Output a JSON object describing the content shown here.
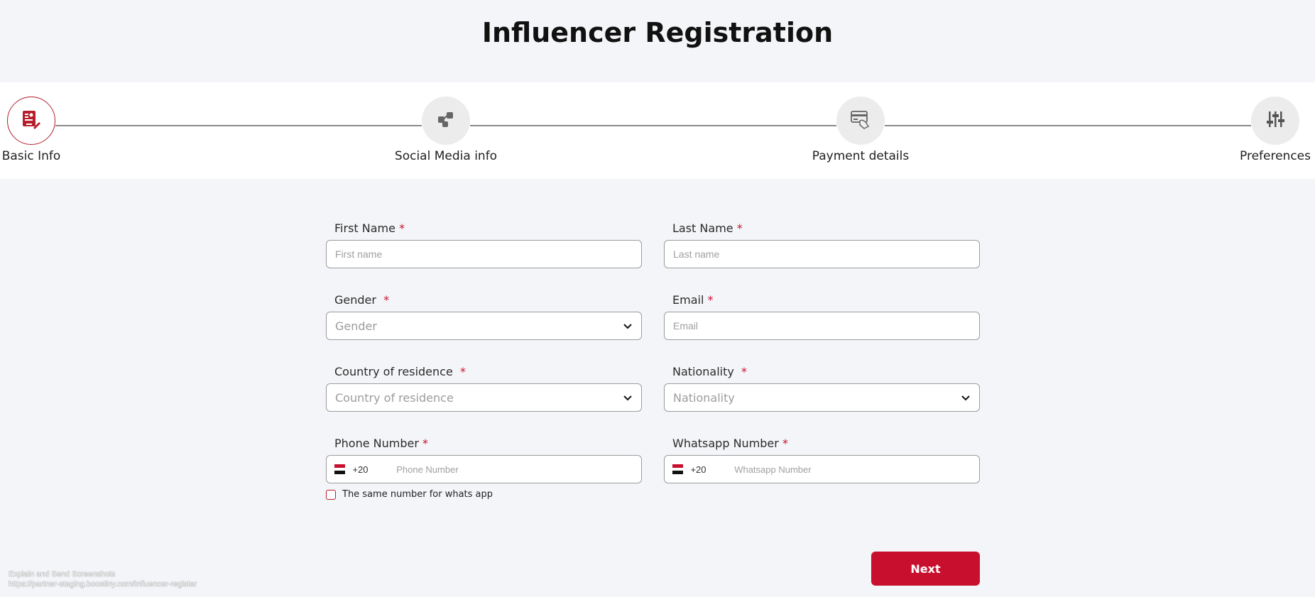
{
  "page": {
    "title": "Influencer Registration"
  },
  "stepper": {
    "steps": [
      {
        "label": "Basic Info",
        "icon": "id-card-icon",
        "active": true
      },
      {
        "label": "Social Media info",
        "icon": "social-network-icon",
        "active": false
      },
      {
        "label": "Payment details",
        "icon": "payment-card-icon",
        "active": false
      },
      {
        "label": "Preferences",
        "icon": "sliders-icon",
        "active": false
      }
    ]
  },
  "form": {
    "first_name": {
      "label": "First Name",
      "required": "*",
      "placeholder": "First name"
    },
    "last_name": {
      "label": "Last Name",
      "required": "*",
      "placeholder": "Last name"
    },
    "gender": {
      "label": "Gender",
      "required": "*",
      "value": "Gender"
    },
    "email": {
      "label": "Email",
      "required": "*",
      "placeholder": "Email"
    },
    "country": {
      "label": "Country of residence",
      "required": "*",
      "value": "Country of residence"
    },
    "nationality": {
      "label": "Nationality",
      "required": "*",
      "value": "Nationality"
    },
    "phone": {
      "label": "Phone Number",
      "required": "*",
      "dial_code": "+20",
      "placeholder": "Phone Number"
    },
    "whatsapp": {
      "label": "Whatsapp Number",
      "required": "*",
      "dial_code": "+20",
      "placeholder": "Whatsapp Number"
    },
    "same_number_checkbox": {
      "label": "The same number for whats app",
      "checked": false
    }
  },
  "actions": {
    "next_label": "Next"
  },
  "footer": {
    "line1": "Explain and Send Screenshots",
    "line2": "https://partner-staging.boostiny.com/influencer-register"
  },
  "colors": {
    "accent": "#c8102e",
    "background": "#f4f5f8"
  }
}
